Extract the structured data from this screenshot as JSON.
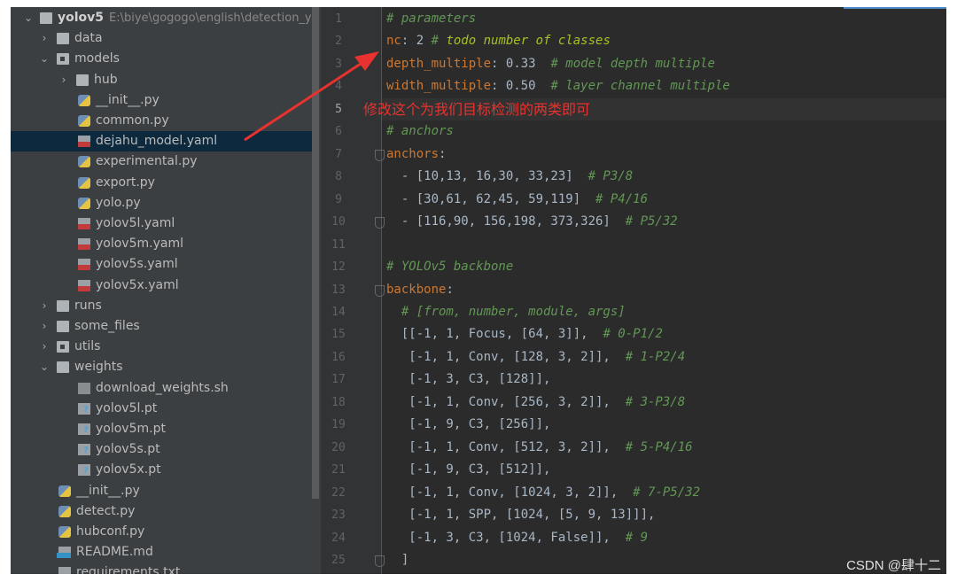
{
  "project_tree": {
    "root": {
      "name": "yolov5",
      "path": "E:\\biye\\gogogo\\english\\detection_y"
    },
    "items": [
      {
        "label": "data",
        "type": "folder",
        "level": 1,
        "expanded": false
      },
      {
        "label": "models",
        "type": "module-folder",
        "level": 1,
        "expanded": true
      },
      {
        "label": "hub",
        "type": "folder",
        "level": 2,
        "expanded": false
      },
      {
        "label": "__init__.py",
        "type": "py",
        "level": 2
      },
      {
        "label": "common.py",
        "type": "py",
        "level": 2
      },
      {
        "label": "dejahu_model.yaml",
        "type": "yaml",
        "level": 2,
        "selected": true
      },
      {
        "label": "experimental.py",
        "type": "py",
        "level": 2
      },
      {
        "label": "export.py",
        "type": "py",
        "level": 2
      },
      {
        "label": "yolo.py",
        "type": "py",
        "level": 2
      },
      {
        "label": "yolov5l.yaml",
        "type": "yaml",
        "level": 2
      },
      {
        "label": "yolov5m.yaml",
        "type": "yaml",
        "level": 2
      },
      {
        "label": "yolov5s.yaml",
        "type": "yaml",
        "level": 2
      },
      {
        "label": "yolov5x.yaml",
        "type": "yaml",
        "level": 2
      },
      {
        "label": "runs",
        "type": "folder",
        "level": 1,
        "expanded": false
      },
      {
        "label": "some_files",
        "type": "folder",
        "level": 1,
        "expanded": false
      },
      {
        "label": "utils",
        "type": "module-folder",
        "level": 1,
        "expanded": false
      },
      {
        "label": "weights",
        "type": "folder",
        "level": 1,
        "expanded": true
      },
      {
        "label": "download_weights.sh",
        "type": "sh",
        "level": 2
      },
      {
        "label": "yolov5l.pt",
        "type": "pt",
        "level": 2
      },
      {
        "label": "yolov5m.pt",
        "type": "pt",
        "level": 2
      },
      {
        "label": "yolov5s.pt",
        "type": "pt",
        "level": 2
      },
      {
        "label": "yolov5x.pt",
        "type": "pt",
        "level": 2
      },
      {
        "label": "__init__.py",
        "type": "py",
        "level": 1
      },
      {
        "label": "detect.py",
        "type": "py",
        "level": 1
      },
      {
        "label": "hubconf.py",
        "type": "py",
        "level": 1
      },
      {
        "label": "README.md",
        "type": "md",
        "level": 1
      },
      {
        "label": "requirements.txt",
        "type": "txt",
        "level": 1
      }
    ]
  },
  "editor": {
    "current_line": 5,
    "lines": [
      [
        [
          "# parameters",
          "c"
        ]
      ],
      [
        [
          "nc",
          "k"
        ],
        [
          ": 2 ",
          "n"
        ],
        [
          "# ",
          "c"
        ],
        [
          "todo number of classes",
          "t"
        ]
      ],
      [
        [
          "depth_multiple",
          "k"
        ],
        [
          ": 0.33  ",
          "n"
        ],
        [
          "# model depth multiple",
          "c"
        ]
      ],
      [
        [
          "width_multiple",
          "k"
        ],
        [
          ": 0.50  ",
          "n"
        ],
        [
          "# layer channel multiple",
          "c"
        ]
      ],
      [],
      [
        [
          "# anchors",
          "c"
        ]
      ],
      [
        [
          "anchors",
          "k"
        ],
        [
          ":",
          "n"
        ]
      ],
      [
        [
          "  - [10,13, 16,30, 33,23]  ",
          "n"
        ],
        [
          "# P3/8",
          "c"
        ]
      ],
      [
        [
          "  - [30,61, 62,45, 59,119]  ",
          "n"
        ],
        [
          "# P4/16",
          "c"
        ]
      ],
      [
        [
          "  - [116,90, 156,198, 373,326]  ",
          "n"
        ],
        [
          "# P5/32",
          "c"
        ]
      ],
      [],
      [
        [
          "# YOLOv5 backbone",
          "c"
        ]
      ],
      [
        [
          "backbone",
          "k"
        ],
        [
          ":",
          "n"
        ]
      ],
      [
        [
          "  # [from, number, module, args]",
          "c"
        ]
      ],
      [
        [
          "  [[-1, 1, Focus, [64, 3]],  ",
          "n"
        ],
        [
          "# 0-P1/2",
          "c"
        ]
      ],
      [
        [
          "   [-1, 1, Conv, [128, 3, 2]],  ",
          "n"
        ],
        [
          "# 1-P2/4",
          "c"
        ]
      ],
      [
        [
          "   [-1, 3, C3, [128]],",
          "n"
        ]
      ],
      [
        [
          "   [-1, 1, Conv, [256, 3, 2]],  ",
          "n"
        ],
        [
          "# 3-P3/8",
          "c"
        ]
      ],
      [
        [
          "   [-1, 9, C3, [256]],",
          "n"
        ]
      ],
      [
        [
          "   [-1, 1, Conv, [512, 3, 2]],  ",
          "n"
        ],
        [
          "# 5-P4/16",
          "c"
        ]
      ],
      [
        [
          "   [-1, 9, C3, [512]],",
          "n"
        ]
      ],
      [
        [
          "   [-1, 1, Conv, [1024, 3, 2]],  ",
          "n"
        ],
        [
          "# 7-P5/32",
          "c"
        ]
      ],
      [
        [
          "   [-1, 1, SPP, [1024, [5, 9, 13]]],",
          "n"
        ]
      ],
      [
        [
          "   [-1, 3, C3, [1024, False]],  ",
          "n"
        ],
        [
          "# 9",
          "c"
        ]
      ],
      [
        [
          "  ]",
          "n"
        ]
      ]
    ]
  },
  "annotation": {
    "text": "修改这个为我们目标检测的两类即可",
    "color": "#e8322f"
  },
  "watermark": "CSDN @肆十二",
  "colors": {
    "editor_bg": "#2b2b2b",
    "sidebar_bg": "#3c3f41",
    "keyword": "#cc7832",
    "comment": "#629755",
    "todo": "#a8c023",
    "selection": "#0d293e"
  }
}
